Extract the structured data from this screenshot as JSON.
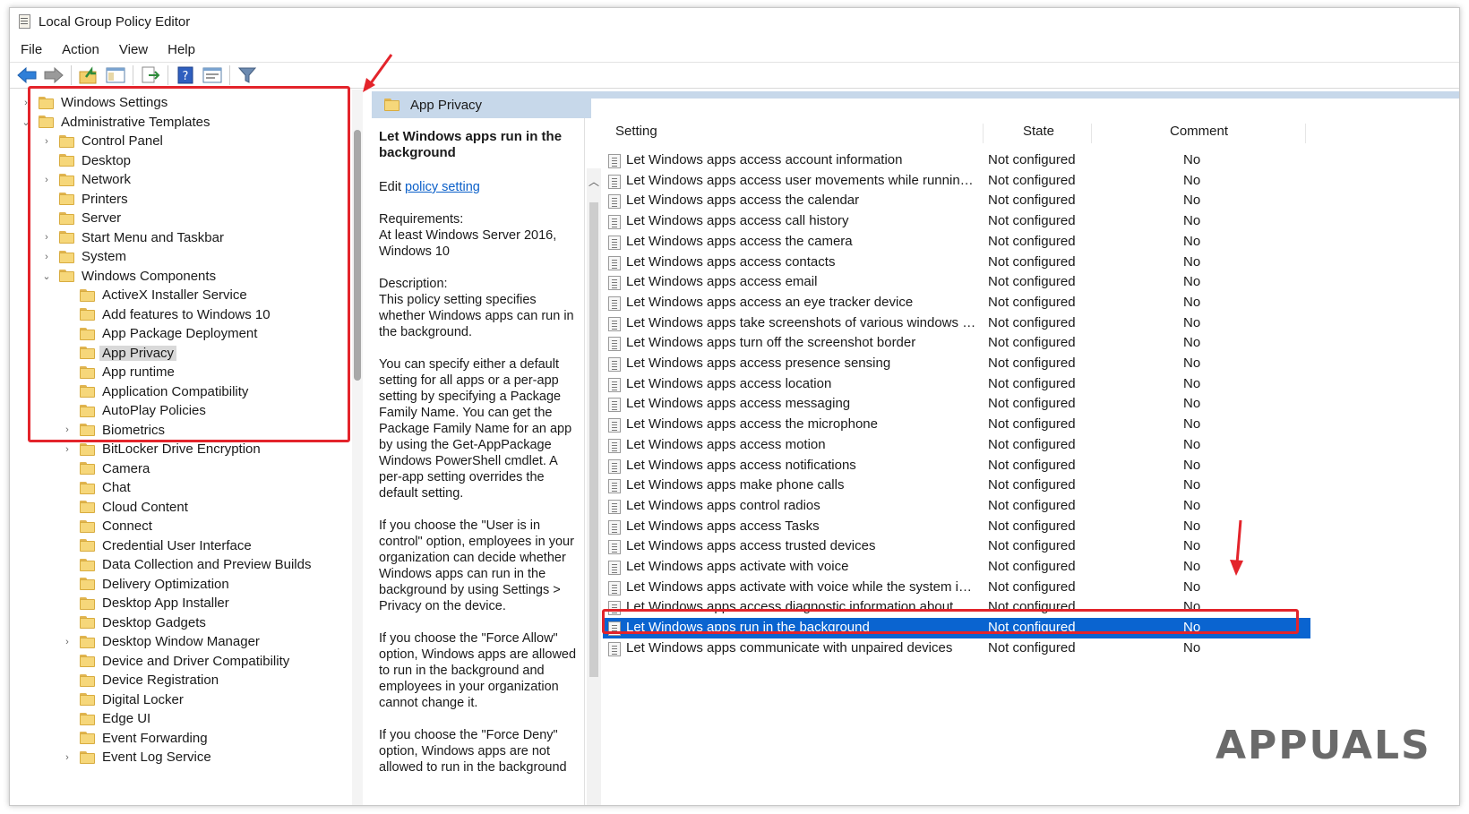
{
  "window": {
    "title": "Local Group Policy Editor"
  },
  "menu": [
    "File",
    "Action",
    "View",
    "Help"
  ],
  "toolbar": {
    "icons": [
      "back-arrow-icon",
      "forward-arrow-icon",
      "up-folder-icon",
      "show-hide-tree-icon",
      "export-list-icon",
      "help-icon",
      "properties-icon",
      "filter-icon"
    ]
  },
  "tree": {
    "items": [
      {
        "label": "Windows Settings",
        "chevron": "›"
      },
      {
        "label": "Administrative Templates",
        "chevron": "⌄"
      },
      {
        "label": "Control Panel",
        "chevron": "›"
      },
      {
        "label": "Desktop",
        "chevron": ""
      },
      {
        "label": "Network",
        "chevron": "›"
      },
      {
        "label": "Printers",
        "chevron": ""
      },
      {
        "label": "Server",
        "chevron": ""
      },
      {
        "label": "Start Menu and Taskbar",
        "chevron": "›"
      },
      {
        "label": "System",
        "chevron": "›"
      },
      {
        "label": "Windows Components",
        "chevron": "⌄"
      },
      {
        "label": "ActiveX Installer Service",
        "chevron": ""
      },
      {
        "label": "Add features to Windows 10",
        "chevron": ""
      },
      {
        "label": "App Package Deployment",
        "chevron": ""
      },
      {
        "label": "App Privacy",
        "chevron": ""
      },
      {
        "label": "App runtime",
        "chevron": ""
      },
      {
        "label": "Application Compatibility",
        "chevron": ""
      },
      {
        "label": "AutoPlay Policies",
        "chevron": ""
      },
      {
        "label": "Biometrics",
        "chevron": "›"
      },
      {
        "label": "BitLocker Drive Encryption",
        "chevron": "›"
      },
      {
        "label": "Camera",
        "chevron": ""
      },
      {
        "label": "Chat",
        "chevron": ""
      },
      {
        "label": "Cloud Content",
        "chevron": ""
      },
      {
        "label": "Connect",
        "chevron": ""
      },
      {
        "label": "Credential User Interface",
        "chevron": ""
      },
      {
        "label": "Data Collection and Preview Builds",
        "chevron": ""
      },
      {
        "label": "Delivery Optimization",
        "chevron": ""
      },
      {
        "label": "Desktop App Installer",
        "chevron": ""
      },
      {
        "label": "Desktop Gadgets",
        "chevron": ""
      },
      {
        "label": "Desktop Window Manager",
        "chevron": "›"
      },
      {
        "label": "Device and Driver Compatibility",
        "chevron": ""
      },
      {
        "label": "Device Registration",
        "chevron": ""
      },
      {
        "label": "Digital Locker",
        "chevron": ""
      },
      {
        "label": "Edge UI",
        "chevron": ""
      },
      {
        "label": "Event Forwarding",
        "chevron": ""
      },
      {
        "label": "Event Log Service",
        "chevron": "›"
      }
    ]
  },
  "panel": {
    "header": "App Privacy",
    "description": {
      "title": "Let Windows apps run in the background",
      "edit_prefix": "Edit ",
      "edit_link": "policy setting",
      "requirements": "Requirements:\nAt least Windows Server 2016, Windows 10",
      "description": "Description:\nThis policy setting specifies whether Windows apps can run in the background.",
      "para1": "You can specify either a default setting for all apps or a per-app setting by specifying a Package Family Name. You can get the Package Family Name for an app by using the Get-AppPackage Windows PowerShell cmdlet. A per-app setting overrides the default setting.",
      "para2": "If you choose the \"User is in control\" option, employees in your organization can decide whether Windows apps can run in the background by using Settings > Privacy on the device.",
      "para3": "If you choose the \"Force Allow\" option, Windows apps are allowed to run in the background and employees in your organization cannot change it.",
      "para4": "If you choose the \"Force Deny\" option, Windows apps are not allowed to run in the background"
    },
    "columns": {
      "setting": "Setting",
      "state": "State",
      "comment": "Comment"
    },
    "rows": [
      {
        "setting": "Let Windows apps access account information",
        "state": "Not configured",
        "comment": "No"
      },
      {
        "setting": "Let Windows apps access user movements while running in t...",
        "state": "Not configured",
        "comment": "No"
      },
      {
        "setting": "Let Windows apps access the calendar",
        "state": "Not configured",
        "comment": "No"
      },
      {
        "setting": "Let Windows apps access call history",
        "state": "Not configured",
        "comment": "No"
      },
      {
        "setting": "Let Windows apps access the camera",
        "state": "Not configured",
        "comment": "No"
      },
      {
        "setting": "Let Windows apps access contacts",
        "state": "Not configured",
        "comment": "No"
      },
      {
        "setting": "Let Windows apps access email",
        "state": "Not configured",
        "comment": "No"
      },
      {
        "setting": "Let Windows apps access an eye tracker device",
        "state": "Not configured",
        "comment": "No"
      },
      {
        "setting": "Let Windows apps take screenshots of various windows or dis...",
        "state": "Not configured",
        "comment": "No"
      },
      {
        "setting": "Let Windows apps turn off the screenshot border",
        "state": "Not configured",
        "comment": "No"
      },
      {
        "setting": "Let Windows apps access presence sensing",
        "state": "Not configured",
        "comment": "No"
      },
      {
        "setting": "Let Windows apps access location",
        "state": "Not configured",
        "comment": "No"
      },
      {
        "setting": "Let Windows apps access messaging",
        "state": "Not configured",
        "comment": "No"
      },
      {
        "setting": "Let Windows apps access the microphone",
        "state": "Not configured",
        "comment": "No"
      },
      {
        "setting": "Let Windows apps access motion",
        "state": "Not configured",
        "comment": "No"
      },
      {
        "setting": "Let Windows apps access notifications",
        "state": "Not configured",
        "comment": "No"
      },
      {
        "setting": "Let Windows apps make phone calls",
        "state": "Not configured",
        "comment": "No"
      },
      {
        "setting": "Let Windows apps control radios",
        "state": "Not configured",
        "comment": "No"
      },
      {
        "setting": "Let Windows apps access Tasks",
        "state": "Not configured",
        "comment": "No"
      },
      {
        "setting": "Let Windows apps access trusted devices",
        "state": "Not configured",
        "comment": "No"
      },
      {
        "setting": "Let Windows apps activate with voice",
        "state": "Not configured",
        "comment": "No"
      },
      {
        "setting": "Let Windows apps activate with voice while the system is lock...",
        "state": "Not configured",
        "comment": "No"
      },
      {
        "setting": "Let Windows apps access diagnostic information about other...",
        "state": "Not configured",
        "comment": "No"
      },
      {
        "setting": "Let Windows apps run in the background",
        "state": "Not configured",
        "comment": "No"
      },
      {
        "setting": "Let Windows apps communicate with unpaired devices",
        "state": "Not configured",
        "comment": "No"
      }
    ]
  },
  "watermark": "APPUALS",
  "colors": {
    "selection": "#0a64d0",
    "highlight": "#e3242b",
    "header_band": "#c7d8ea"
  }
}
